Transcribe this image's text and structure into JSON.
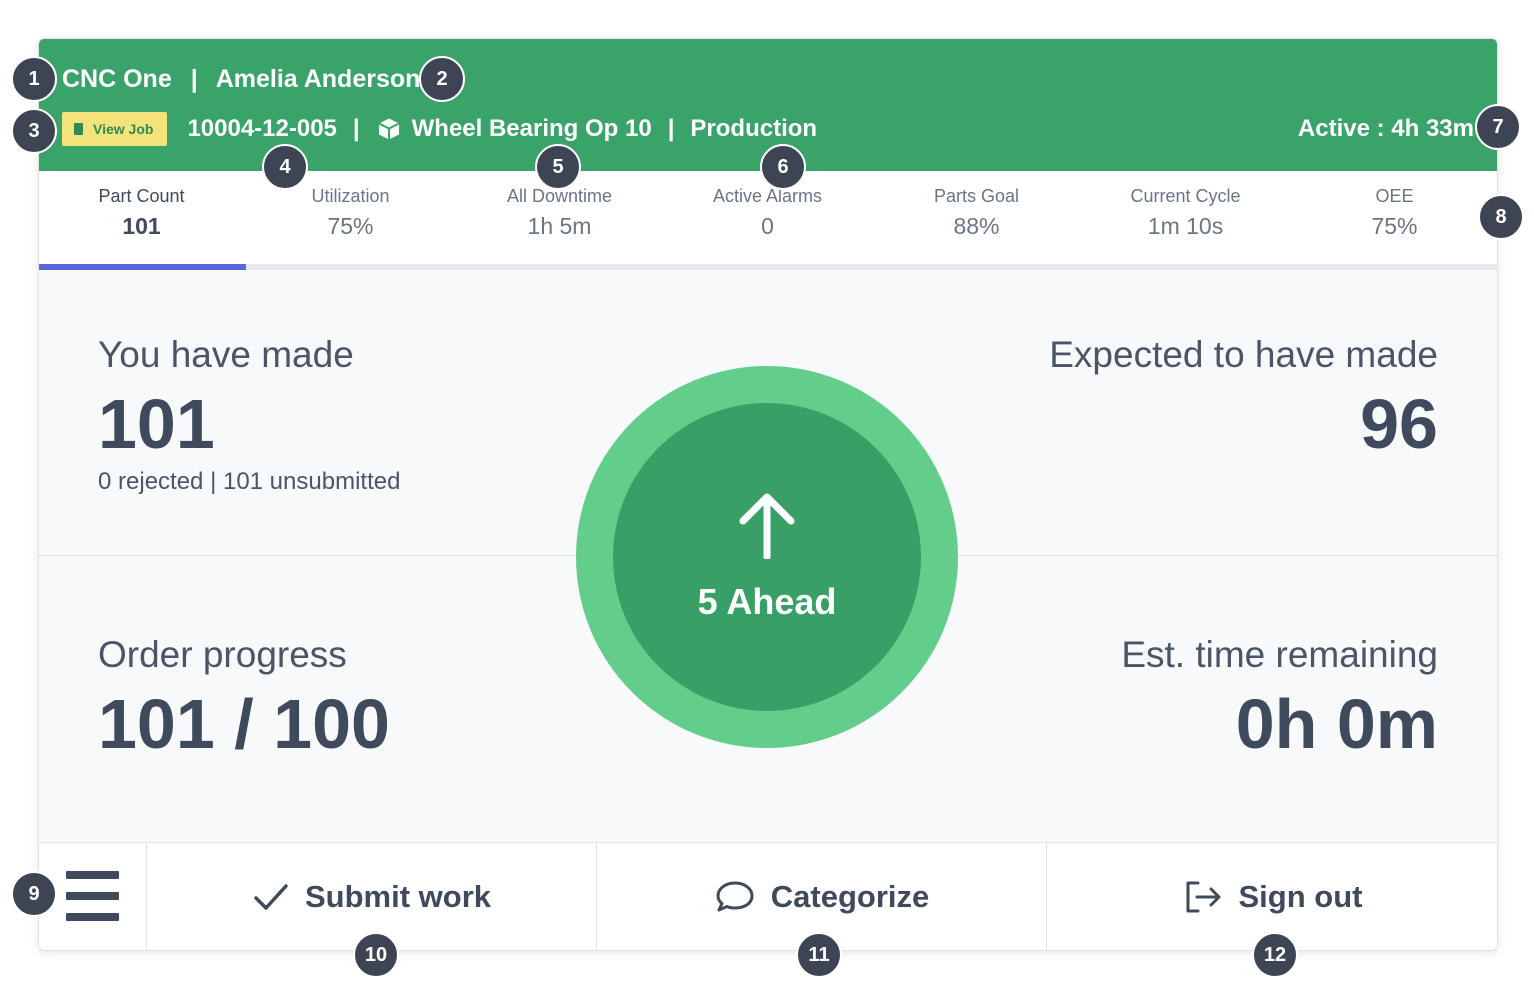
{
  "header": {
    "machine": "CNC One",
    "separator": "|",
    "operator": "Amelia Anderson",
    "view_job_label": "View Job",
    "job_number": "10004-12-005",
    "part_name": "Wheel Bearing Op 10",
    "mode": "Production",
    "active_status": "Active : 4h 33m"
  },
  "tabs": [
    {
      "label": "Part Count",
      "value": "101"
    },
    {
      "label": "Utilization",
      "value": "75%"
    },
    {
      "label": "All Downtime",
      "value": "1h 5m"
    },
    {
      "label": "Active Alarms",
      "value": "0"
    },
    {
      "label": "Parts Goal",
      "value": "88%"
    },
    {
      "label": "Current Cycle",
      "value": "1m 10s"
    },
    {
      "label": "OEE",
      "value": "75%"
    }
  ],
  "main": {
    "made_label": "You have made",
    "made_value": "101",
    "made_detail": "0 rejected | 101 unsubmitted",
    "expected_label": "Expected to have made",
    "expected_value": "96",
    "order_label": "Order progress",
    "order_value": "101 / 100",
    "remaining_label": "Est. time remaining",
    "remaining_value": "0h 0m",
    "ahead_label": "5 Ahead"
  },
  "footer": {
    "submit_label": "Submit work",
    "categorize_label": "Categorize",
    "signout_label": "Sign out"
  },
  "callouts": [
    "1",
    "2",
    "3",
    "4",
    "5",
    "6",
    "7",
    "8",
    "9",
    "10",
    "11",
    "12"
  ],
  "colors": {
    "header_green": "#3aa36a",
    "ring_outer": "#63ce8b",
    "ring_inner": "#38a066",
    "tab_indicator": "#5966d8",
    "view_job_bg": "#f4e27a",
    "text_dark": "#3f4a5c",
    "badge": "#3d4454"
  }
}
